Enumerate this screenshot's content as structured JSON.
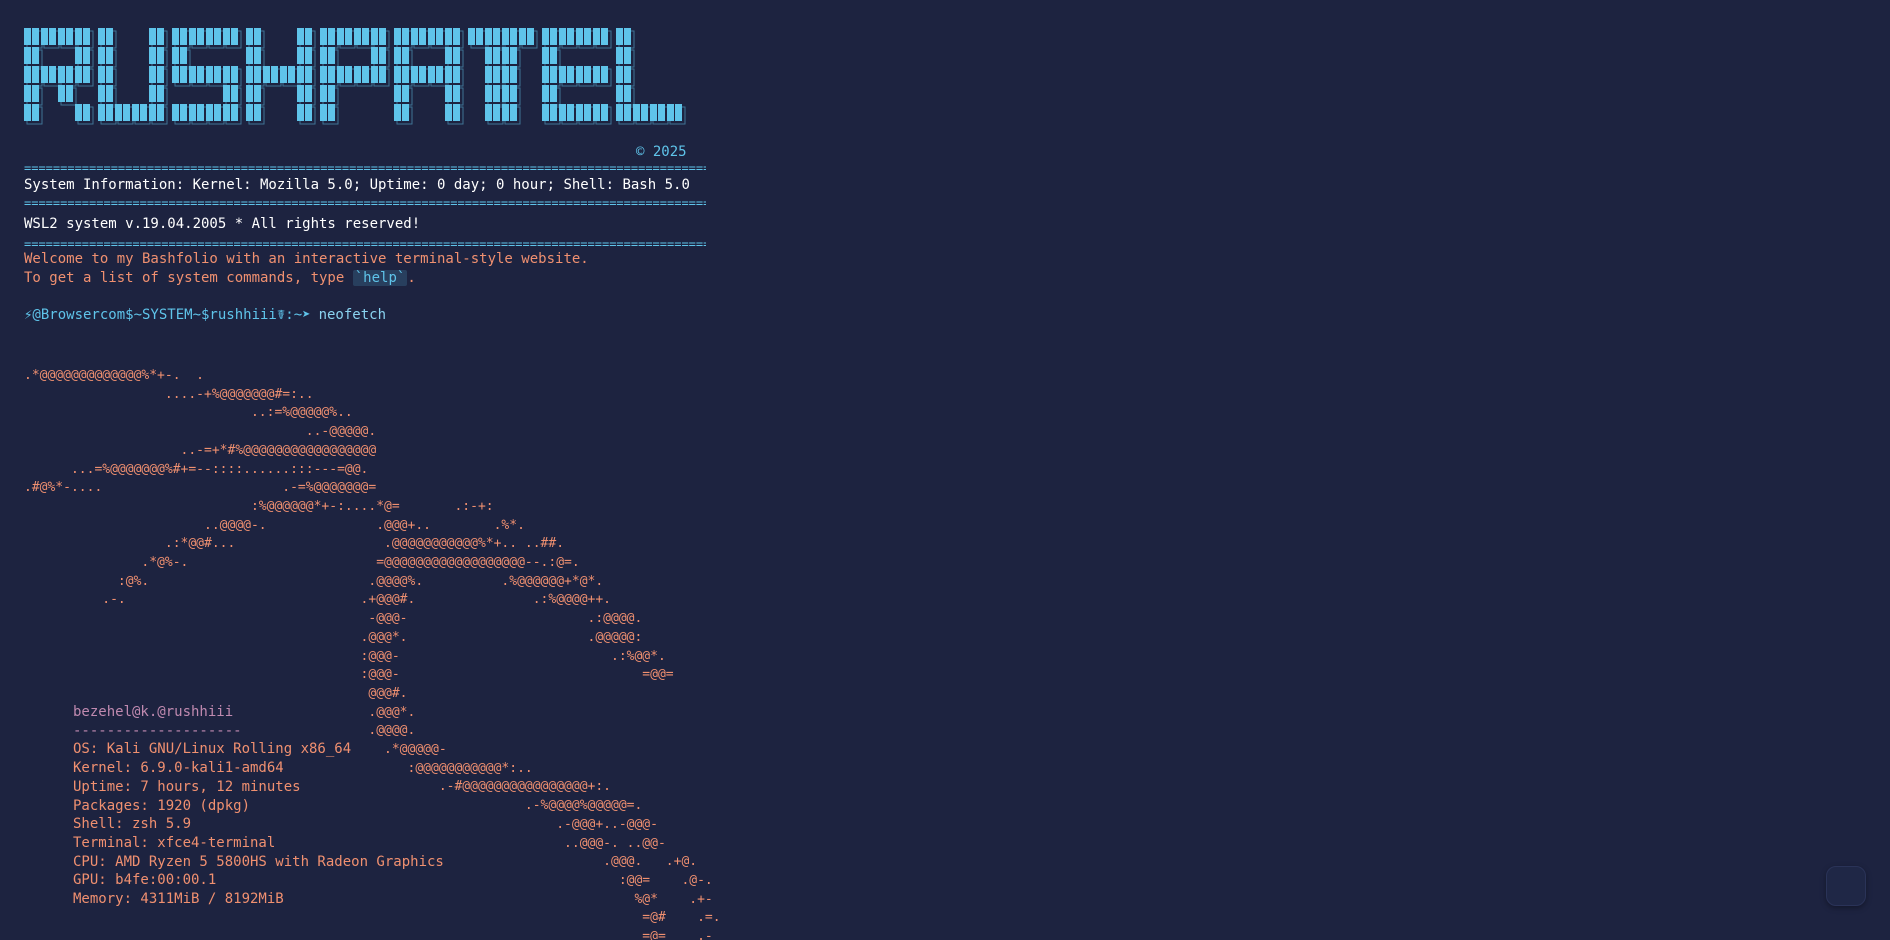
{
  "banner": {
    "alt_text": "RUSHPATEL"
  },
  "copyright": "© 2025",
  "separator": "=================================================================================================================================",
  "system_info": "System Information: Kernel: Mozilla 5.0; Uptime: 0 day; 0 hour; Shell: Bash 5.0",
  "wsl_line": "WSL2 system v.19.04.2005 * All rights reserved!",
  "welcome_line1": "Welcome to my Bashfolio with an interactive terminal-style website.",
  "welcome_line2_prefix": "To get a list of system commands, type ",
  "welcome_help": "`help`",
  "welcome_line2_suffix": ".",
  "prompt": {
    "text": "⚡@Browsercom$~SYSTEM~$rushhiii☤:~➤",
    "command": "neofetch"
  },
  "ascii_art": [
    ".*@@@@@@@@@@@@@%*+-.  .",
    "                  ....-+%@@@@@@@#=:..",
    "                             ..:=%@@@@@%..",
    "                                    ..-@@@@@.",
    "                    ..-=+*#%@@@@@@@@@@@@@@@@@",
    "      ...=%@@@@@@@%#+=--::::......:::---=@@.",
    ".#@%*-....                       .-=%@@@@@@@=",
    "                             :%@@@@@@*+-:....*@=       .:-+:",
    "                       ..@@@@-.              .@@@+..        .%*.",
    "                  .:*@@#...                   .@@@@@@@@@@@%*+.. ..##.",
    "               .*@%-.                        =@@@@@@@@@@@@@@@@@@--.:@=.",
    "            :@%.                            .@@@@%.          .%@@@@@@+*@*.",
    "          .-.                              .+@@@#.               .:%@@@@++.",
    "                                            -@@@-                       .:@@@@.",
    "                                           .@@@*.                       .@@@@@:",
    "                                           :@@@-                           .:%@@*.",
    "                                           :@@@-                               =@@=",
    "                                            @@@#.",
    "                                            .@@@*.",
    "                                            .@@@@.",
    "                                              .*@@@@@-",
    "                                                 :@@@@@@@@@@@*:..",
    "                                                     .-#@@@@@@@@@@@@@@@@+:.",
    "                                                                .-%@@@@%@@@@@=.",
    "                                                                    .-@@@+..-@@@-",
    "                                                                     ..@@@-. ..@@-",
    "                                                                          .@@@.   .+@.",
    "                                                                            :@@=    .@-.",
    "                                                                              %@*    .+-",
    "                                                                               =@#    .=.",
    "                                                                               =@=    .-"
  ],
  "neofetch": {
    "user": "bezehel@k.@rushhiii",
    "dash": "--------------------",
    "os": "OS: Kali GNU/Linux Rolling x86_64",
    "kernel": "Kernel: 6.9.0-kali1-amd64",
    "uptime": "Uptime: 7 hours, 12 minutes",
    "packages": "Packages: 1920 (dpkg)",
    "shell": "Shell: zsh 5.9",
    "terminal": "Terminal: xfce4-terminal",
    "cpu": "CPU: AMD Ryzen 5 5800HS with Radeon Graphics",
    "gpu": "GPU: b4fe:00:00.1",
    "memory": "Memory: 4311MiB / 8192MiB"
  },
  "colors": {
    "background": "#1d2340",
    "accent": "#5fc4ea",
    "art": "#f09070",
    "user": "#c08ab0"
  }
}
